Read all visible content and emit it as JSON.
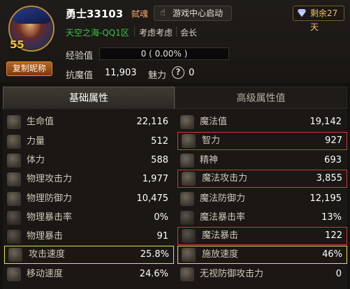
{
  "profile": {
    "level": "55",
    "copy_nickname_label": "复制昵称",
    "name": "勇士33103",
    "job": "弑魂",
    "launch_label": "游戏中心启动",
    "days_left": "剩余27天",
    "server": "天空之海-QQ1区",
    "guild": "考虑考虑",
    "rank": "会长",
    "exp_label": "经验值",
    "exp_value": "0 ( 0.00% )",
    "exp_progress": 0,
    "resist_label": "抗魔值",
    "resist_value": "11,903",
    "charm_label": "魅力",
    "charm_help": "?",
    "charm_value": "0"
  },
  "tabs": [
    {
      "label": "基础属性",
      "active": true
    },
    {
      "label": "高级属性值",
      "active": false
    }
  ],
  "stats_left": [
    {
      "label": "生命值",
      "value": "22,116",
      "icon": "heart-icon"
    },
    {
      "label": "力量",
      "value": "512",
      "icon": "strength-icon"
    },
    {
      "label": "体力",
      "value": "588",
      "icon": "stamina-icon"
    },
    {
      "label": "物理攻击力",
      "value": "1,977",
      "icon": "sword-icon"
    },
    {
      "label": "物理防御力",
      "value": "10,475",
      "icon": "shield-icon"
    },
    {
      "label": "物理暴击率",
      "value": "0%",
      "icon": "crit-rate-icon"
    },
    {
      "label": "物理暴击",
      "value": "91",
      "icon": "crit-icon"
    },
    {
      "label": "攻击速度",
      "value": "25.8%",
      "icon": "attack-speed-icon"
    },
    {
      "label": "移动速度",
      "value": "24.6%",
      "icon": "boot-icon"
    }
  ],
  "stats_right": [
    {
      "label": "魔法值",
      "value": "19,142",
      "icon": "mana-heart-icon"
    },
    {
      "label": "智力",
      "value": "927",
      "icon": "intelligence-icon"
    },
    {
      "label": "精神",
      "value": "693",
      "icon": "spirit-icon"
    },
    {
      "label": "魔法攻击力",
      "value": "3,855",
      "icon": "magic-attack-icon"
    },
    {
      "label": "魔法防御力",
      "value": "12,195",
      "icon": "magic-defense-icon"
    },
    {
      "label": "魔法暴击率",
      "value": "13%",
      "icon": "magic-crit-rate-icon"
    },
    {
      "label": "魔法暴击",
      "value": "122",
      "icon": "magic-crit-icon"
    },
    {
      "label": "施放速度",
      "value": "46%",
      "icon": "cast-speed-icon"
    },
    {
      "label": "无视防御攻击力",
      "value": "0",
      "icon": "ignore-defense-icon"
    }
  ],
  "colors": {
    "highlight_red": "#d03a3a",
    "highlight_yellow": "#e6e04a",
    "server_green": "#3cc24a",
    "level_gold": "#f0c040"
  }
}
